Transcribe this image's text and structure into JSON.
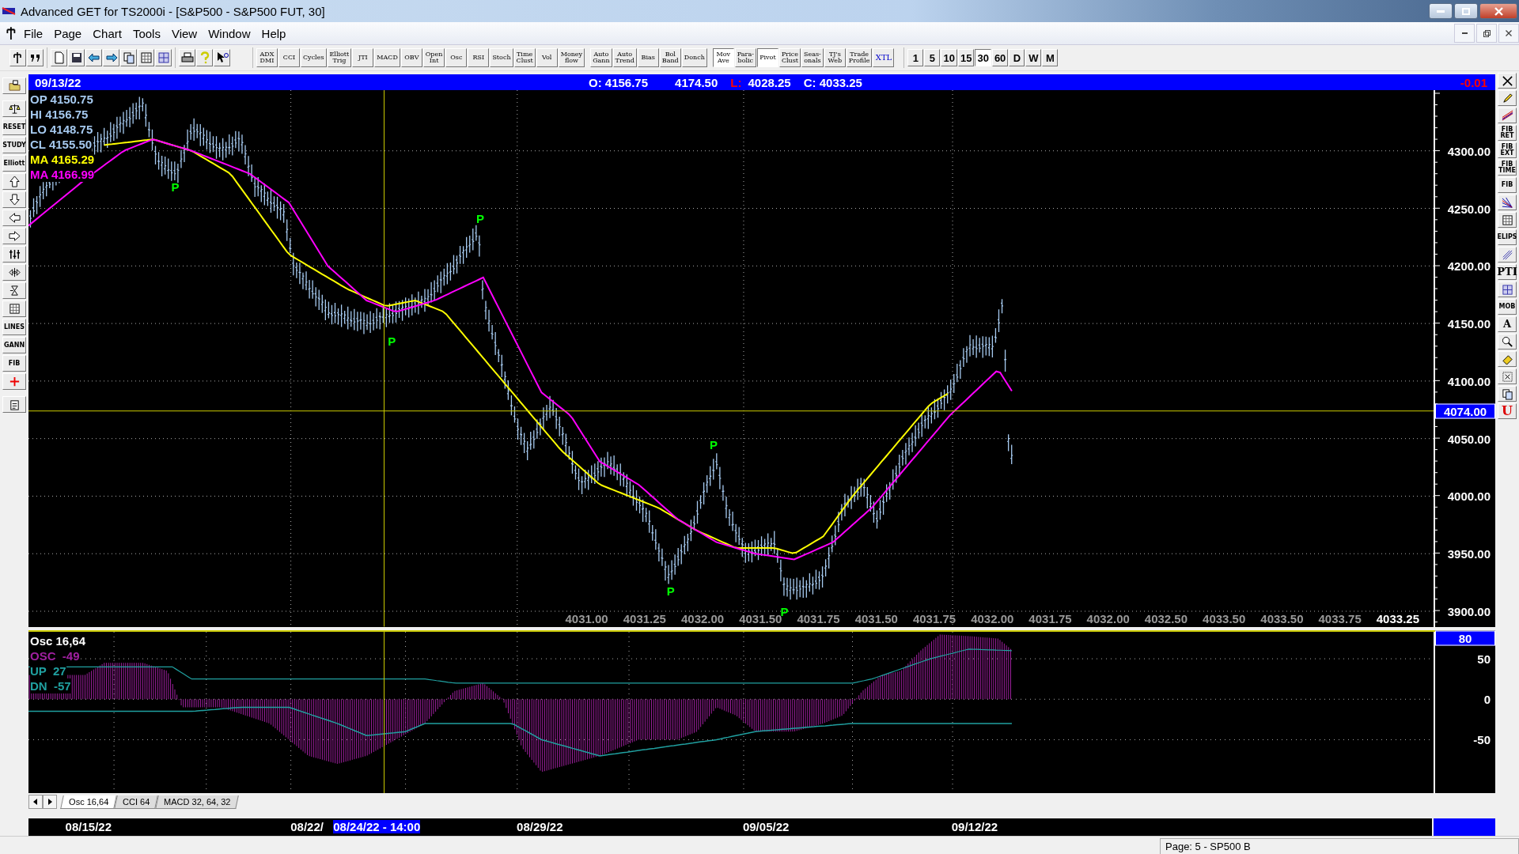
{
  "window": {
    "title": "Advanced GET for TS2000i - [S&P500 - S&P500 FUT, 30]"
  },
  "menu": [
    "File",
    "Page",
    "Chart",
    "Tools",
    "View",
    "Window",
    "Help"
  ],
  "studies": [
    {
      "label": "ADX\nDMI",
      "selected": false
    },
    {
      "label": "CCI",
      "selected": false
    },
    {
      "label": "Cycles",
      "selected": false
    },
    {
      "label": "Elliott\nTrig",
      "selected": false
    },
    {
      "label": "JTI",
      "selected": false
    },
    {
      "label": "MACD",
      "selected": false
    },
    {
      "label": "OBV",
      "selected": false
    },
    {
      "label": "Open\nInt",
      "selected": false
    },
    {
      "label": "Osc",
      "selected": false
    },
    {
      "label": "RSI",
      "selected": false
    },
    {
      "label": "Stoch",
      "selected": false
    },
    {
      "label": "Time\nClust",
      "selected": false
    },
    {
      "label": "Vol",
      "selected": false
    },
    {
      "label": "Money\nflow",
      "selected": false
    },
    {
      "label": "Auto\nGann",
      "selected": false
    },
    {
      "label": "Auto\nTrend",
      "selected": false
    },
    {
      "label": "Bias",
      "selected": false
    },
    {
      "label": "Bol\nBand",
      "selected": false
    },
    {
      "label": "Donch",
      "selected": false
    },
    {
      "label": "Mov\nAve",
      "selected": true
    },
    {
      "label": "Para-\nbolic",
      "selected": false
    },
    {
      "label": "Pivot",
      "selected": true
    },
    {
      "label": "Price\nClust",
      "selected": false
    },
    {
      "label": "Seas-\nonals",
      "selected": false
    },
    {
      "label": "TJ's\nWeb",
      "selected": false
    },
    {
      "label": "Trade\nProfile",
      "selected": false
    },
    {
      "label": "XTL",
      "selected": false
    }
  ],
  "intervals": [
    {
      "label": "1",
      "selected": false
    },
    {
      "label": "5",
      "selected": false
    },
    {
      "label": "10",
      "selected": false
    },
    {
      "label": "15",
      "selected": false
    },
    {
      "label": "30",
      "selected": true
    },
    {
      "label": "60",
      "selected": false
    },
    {
      "label": "D",
      "selected": false
    },
    {
      "label": "W",
      "selected": false
    },
    {
      "label": "M",
      "selected": false
    }
  ],
  "info_bar": {
    "date": "09/13/22",
    "open": "O: 4156.75",
    "high": "4174.50",
    "low_label": "L:",
    "low": "4028.25",
    "close": "C: 4033.25",
    "change": "-0.01"
  },
  "legend": [
    {
      "label": "OP",
      "value": "4150.75",
      "color": "#a6caf0"
    },
    {
      "label": "HI",
      "value": "4156.75",
      "color": "#a6caf0"
    },
    {
      "label": "LO",
      "value": "4148.75",
      "color": "#a6caf0"
    },
    {
      "label": "CL",
      "value": "4155.50",
      "color": "#a6caf0"
    },
    {
      "label": "MA",
      "value": "4165.29",
      "color": "#ffff00"
    },
    {
      "label": "MA",
      "value": "4166.99",
      "color": "#ff00ff"
    }
  ],
  "price_axis": {
    "ticks": [
      "4300.00",
      "4250.00",
      "4200.00",
      "4150.00",
      "4100.00",
      "4050.00",
      "4000.00",
      "3950.00",
      "3900.00"
    ],
    "marker": "4074.00"
  },
  "value_row": [
    "4031.00",
    "4031.25",
    "4032.00",
    "4031.50",
    "4031.75",
    "4031.50",
    "4031.75",
    "4032.00",
    "4031.75",
    "4032.00",
    "4032.50",
    "4033.50",
    "4033.50",
    "4033.75",
    "4033.25"
  ],
  "pivot_markers": [
    "P",
    "P",
    "P",
    "P",
    "P",
    "P"
  ],
  "oscillator": {
    "title": "Osc 16,64",
    "legend": [
      {
        "label": "OSC",
        "value": "-49",
        "color": "#a020a0"
      },
      {
        "label": "UP",
        "value": "27",
        "color": "#20a0a0"
      },
      {
        "label": "DN",
        "value": "-57",
        "color": "#20a0a0"
      }
    ],
    "axis": [
      "80",
      "50",
      "0",
      "-50"
    ]
  },
  "tabs": [
    {
      "label": "Osc 16,64",
      "selected": true
    },
    {
      "label": "CCI 64",
      "selected": false
    },
    {
      "label": "MACD 32, 64, 32",
      "selected": false
    }
  ],
  "dates": [
    "08/15/22",
    "08/22/",
    "08/29/22",
    "09/05/22",
    "09/12/22"
  ],
  "cursor_date": "08/24/22 - 14:00",
  "left_tools": [
    "RESET",
    "STUDY",
    "Elliott",
    "LINES",
    "GANN",
    "FIB"
  ],
  "right_tools": [
    "FIB\nRET",
    "FIB\nEXT",
    "FIB\nTIME",
    "FIB",
    "ELIPS",
    "PTI",
    "MOB",
    "A",
    "U"
  ],
  "status_bar": "Page: 5 - SP500 B"
}
